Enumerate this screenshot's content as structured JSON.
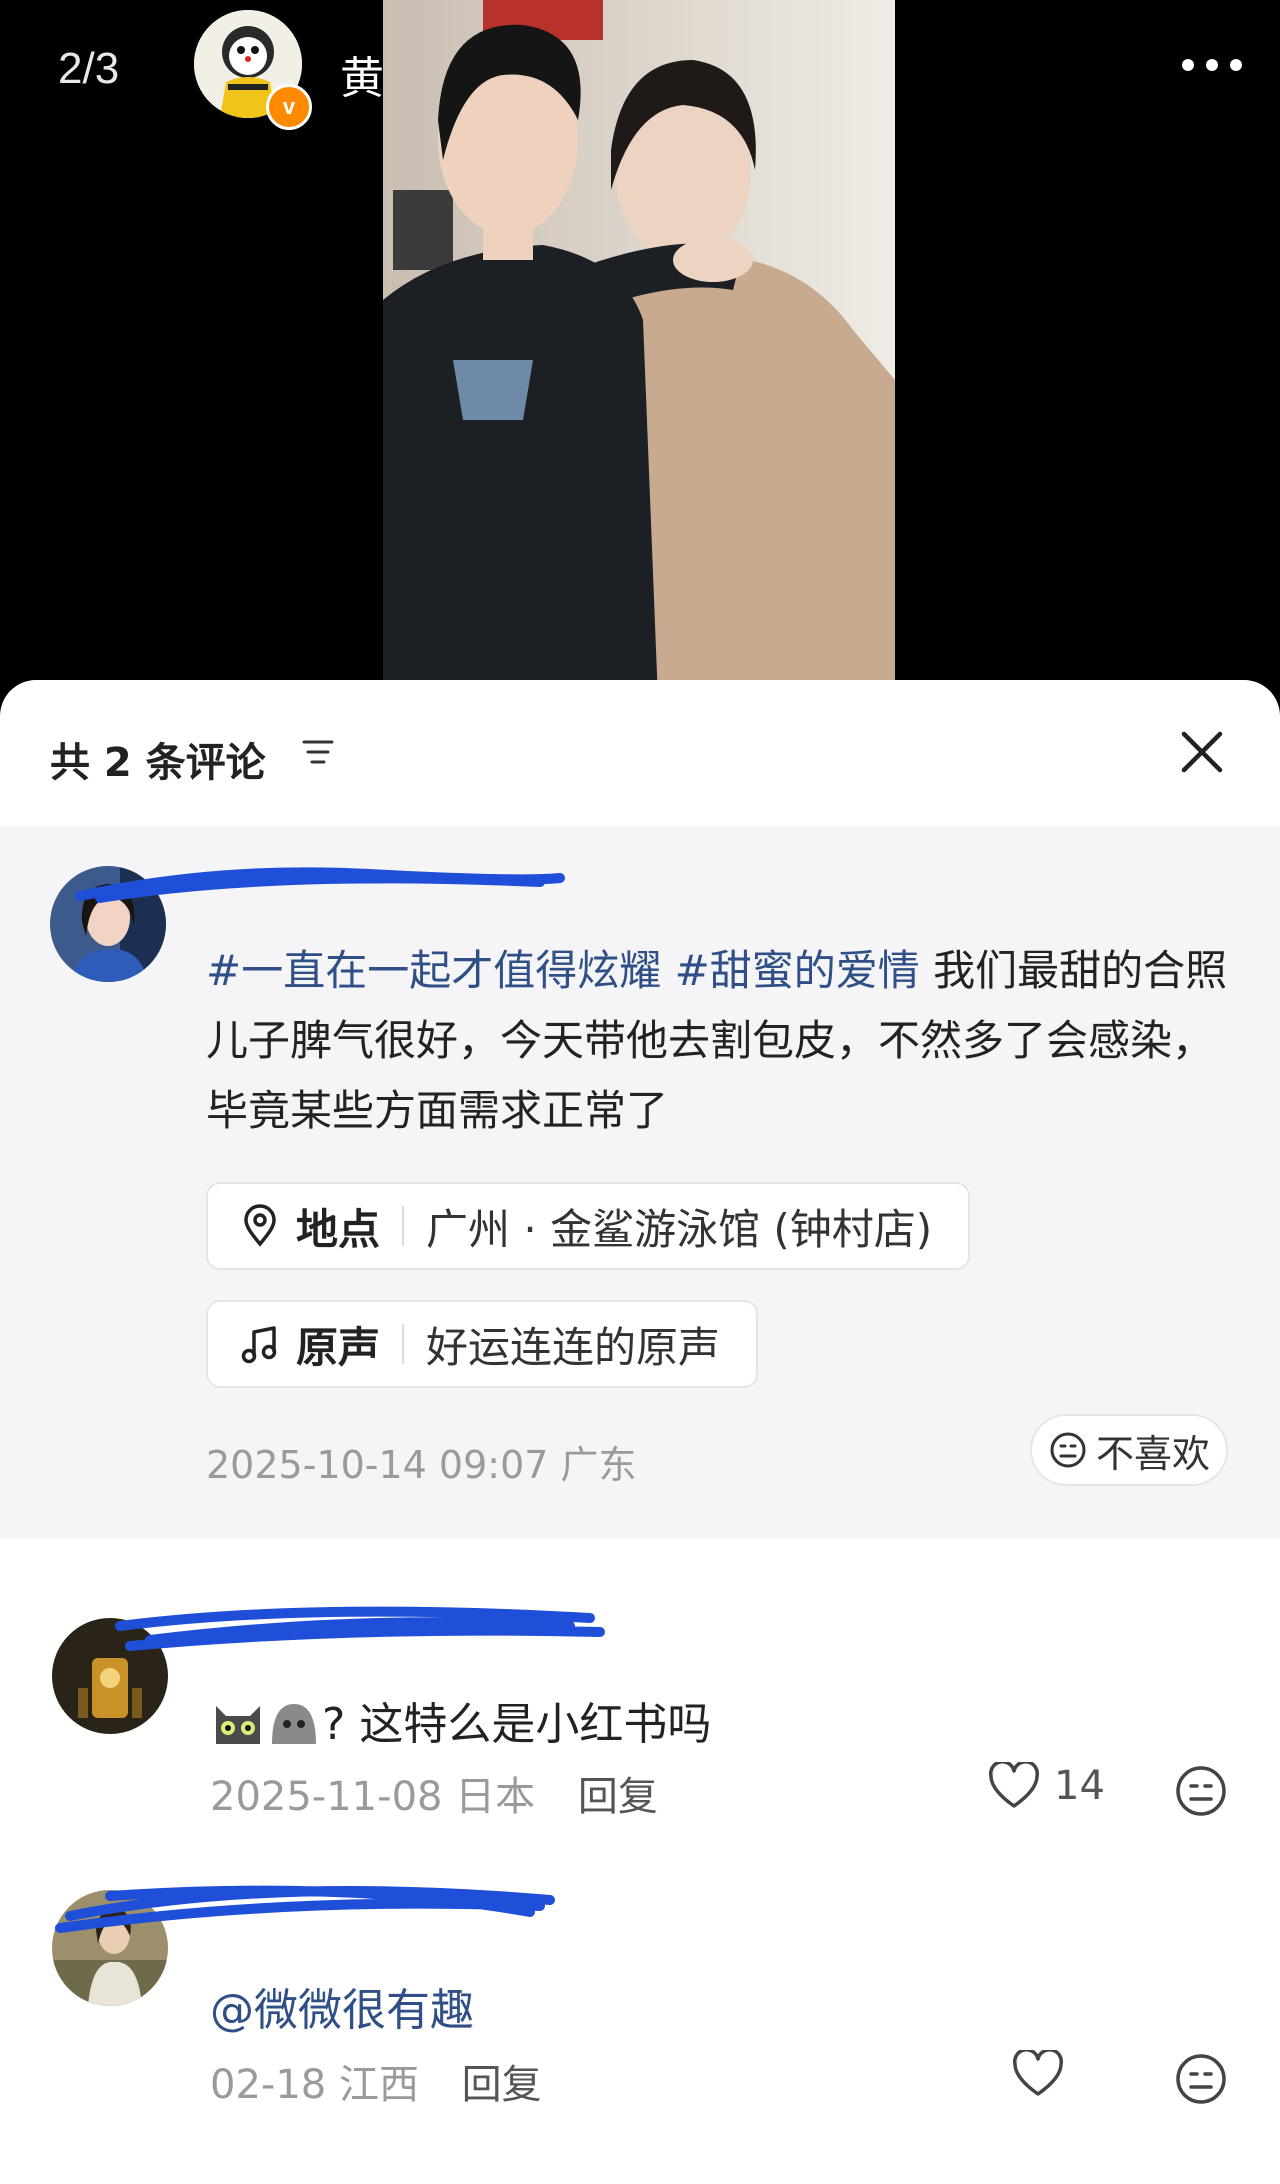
{
  "header": {
    "counter": "2/3",
    "author_name": "黄西炮",
    "verify_badge": "v"
  },
  "sheet": {
    "title": "共 2 条评论"
  },
  "main_post": {
    "tag1": "#一直在一起才值得炫耀",
    "tag2": "#甜蜜的爱情",
    "text": " 我们最甜的合照 儿子脾气很好，今天带他去割包皮，不然多了会感染，毕竟某些方面需求正常了",
    "location_label": "地点",
    "location_value": "广州 · 金鲨游泳馆 (钟村店)",
    "audio_label": "原声",
    "audio_value": "好运连连的原声",
    "meta": "2025-10-14 09:07 广东",
    "dislike_label": "不喜欢"
  },
  "comments": [
    {
      "text": "? 这特么是小红书吗",
      "date": "2025-11-08 日本",
      "reply_label": "回复",
      "likes": "14"
    },
    {
      "text": "@微微很有趣",
      "date": "02-18 江西",
      "reply_label": "回复",
      "likes": ""
    }
  ]
}
